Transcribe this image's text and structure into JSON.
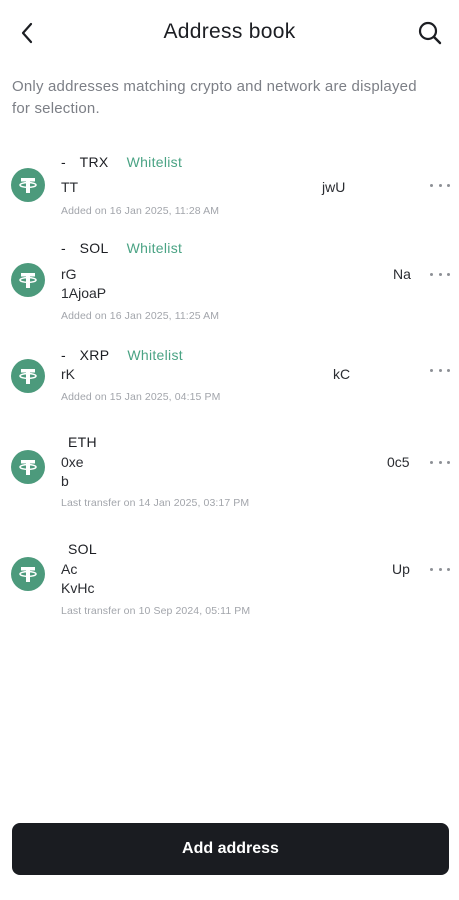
{
  "header": {
    "title": "Address book",
    "back_icon": "chevron-left-icon",
    "search_icon": "search-icon"
  },
  "notice": "Only addresses matching crypto and network are displayed for selection.",
  "entries": [
    {
      "prefix": "-",
      "network": "TRX",
      "whitelist": "Whitelist",
      "addr_left_1": "TT",
      "addr_left_2": "",
      "addr_right": "jwU",
      "meta": "Added on 16 Jan 2025, 11:28 AM"
    },
    {
      "prefix": "-",
      "network": "SOL",
      "whitelist": "Whitelist",
      "addr_left_1": "rG",
      "addr_left_2": "1AjoaP",
      "addr_right": "Na",
      "meta": "Added on 16 Jan 2025, 11:25 AM"
    },
    {
      "prefix": "-",
      "network": "XRP",
      "whitelist": "Whitelist",
      "addr_left_1": "rK",
      "addr_left_2": "",
      "addr_right": "kC",
      "meta": "Added on 15 Jan 2025, 04:15 PM"
    },
    {
      "prefix": "",
      "network": "ETH",
      "whitelist": "",
      "addr_left_1": "0xe",
      "addr_left_2": "b",
      "addr_right": "0c5",
      "meta": "Last transfer on 14 Jan 2025, 03:17 PM"
    },
    {
      "prefix": "",
      "network": "SOL",
      "whitelist": "",
      "addr_left_1": "Ac",
      "addr_left_2": "KvHc",
      "addr_right": "Up",
      "meta": "Last transfer on 10 Sep 2024, 05:11 PM"
    }
  ],
  "coin_icon": "tether-usdt-icon",
  "more_icon": "more-horizontal-icon",
  "add_button": "Add address",
  "colors": {
    "accent_green": "#4aa384",
    "coin_green": "#4c9a7c",
    "button_dark": "#1a1c21"
  }
}
